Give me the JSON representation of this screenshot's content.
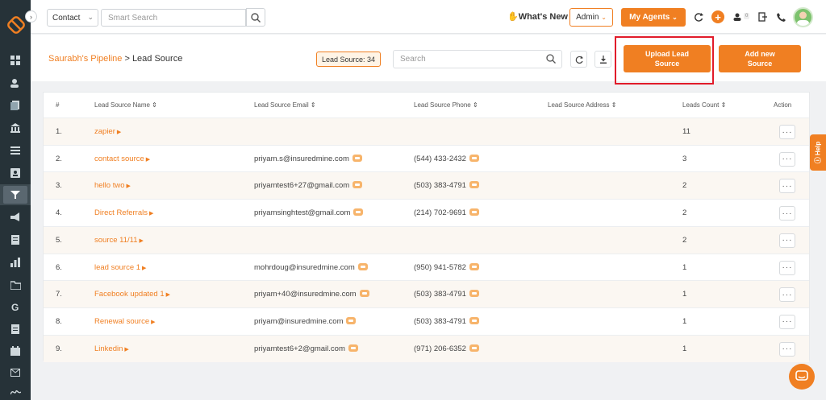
{
  "topbar": {
    "contact_select": "Contact",
    "smart_search_placeholder": "Smart Search",
    "whats_new": "What's New",
    "admin": "Admin",
    "my_agents": "My Agents",
    "notification_count": "0"
  },
  "header": {
    "breadcrumb_parent": "Saurabh's Pipeline",
    "breadcrumb_current": "Lead Source",
    "count_badge": "Lead Source: 34",
    "search_placeholder": "Search",
    "upload_btn": "Upload Lead Source",
    "add_btn": "Add new Source"
  },
  "table": {
    "headers": [
      "#",
      "Lead Source Name",
      "Lead Source Email",
      "Lead Source Phone",
      "Lead Source Address",
      "Leads Count",
      "Action"
    ],
    "rows": [
      {
        "num": "1.",
        "name": "zapier",
        "email": "",
        "phone": "",
        "count": "11"
      },
      {
        "num": "2.",
        "name": "contact source",
        "email": "priyam.s@insuredmine.com",
        "phone": "(544) 433-2432",
        "count": "3"
      },
      {
        "num": "3.",
        "name": "hello two",
        "email": "priyamtest6+27@gmail.com",
        "phone": "(503) 383-4791",
        "count": "2"
      },
      {
        "num": "4.",
        "name": "Direct Referrals",
        "email": "priyamsinghtest@gmail.com",
        "phone": "(214) 702-9691",
        "count": "2"
      },
      {
        "num": "5.",
        "name": "source 11/11",
        "email": "",
        "phone": "",
        "count": "2"
      },
      {
        "num": "6.",
        "name": "lead source 1",
        "email": "mohrdoug@insuredmine.com",
        "phone": "(950) 941-5782",
        "count": "1"
      },
      {
        "num": "7.",
        "name": "Facebook updated 1",
        "email": "priyam+40@insuredmine.com",
        "phone": "(503) 383-4791",
        "count": "1"
      },
      {
        "num": "8.",
        "name": "Renewal source",
        "email": "priyam@insuredmine.com",
        "phone": "(503) 383-4791",
        "count": "1"
      },
      {
        "num": "9.",
        "name": "Linkedin",
        "email": "priyamtest6+2@gmail.com",
        "phone": "(971) 206-6352",
        "count": "1"
      }
    ],
    "action_label": "···"
  },
  "help": "Help",
  "colors": {
    "accent": "#f07f22",
    "sidebar": "#263238",
    "highlight": "#e11b2a"
  }
}
